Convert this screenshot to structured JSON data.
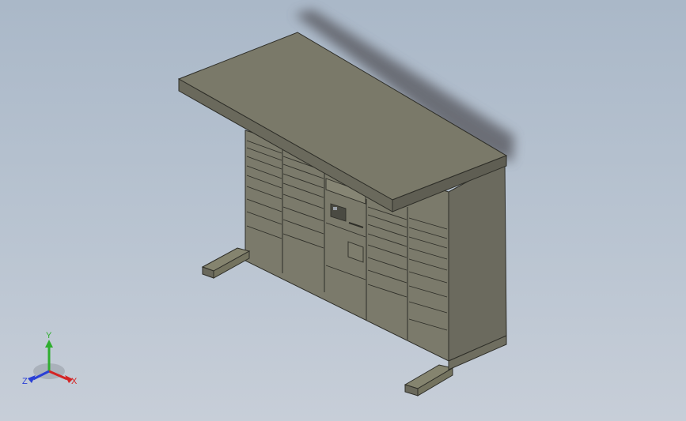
{
  "viewport": {
    "background_top": "#aab8c8",
    "background_bottom": "#c7ced8"
  },
  "model": {
    "body_color": "#7b7a6b",
    "body_light": "#84836f",
    "roof_color": "#7a7969",
    "side_color": "#6b6a5e",
    "edge_color": "#2e2e28",
    "shadow_color": "#5e6068"
  },
  "triad": {
    "x_label": "X",
    "y_label": "Y",
    "z_label": "Z",
    "x_color": "#d42424",
    "y_color": "#2fae2f",
    "z_color": "#2a3fd6"
  }
}
